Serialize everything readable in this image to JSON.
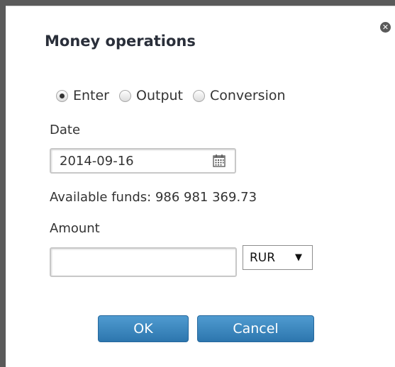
{
  "dialog": {
    "title": "Money operations",
    "close_icon": "close-icon"
  },
  "operation_type": {
    "options": [
      {
        "label": "Enter",
        "checked": true
      },
      {
        "label": "Output",
        "checked": false
      },
      {
        "label": "Conversion",
        "checked": false
      }
    ]
  },
  "date": {
    "label": "Date",
    "value": "2014-09-16",
    "icon": "calendar-icon"
  },
  "funds": {
    "text": "Available funds: 986 981 369.73"
  },
  "amount": {
    "label": "Amount",
    "value": "",
    "placeholder": ""
  },
  "currency": {
    "selected": "RUR",
    "icon": "dropdown-arrow-icon"
  },
  "buttons": {
    "ok_label": "OK",
    "cancel_label": "Cancel"
  },
  "colors": {
    "button_primary": "#2d76ae",
    "backdrop": "#5a5a5a"
  }
}
